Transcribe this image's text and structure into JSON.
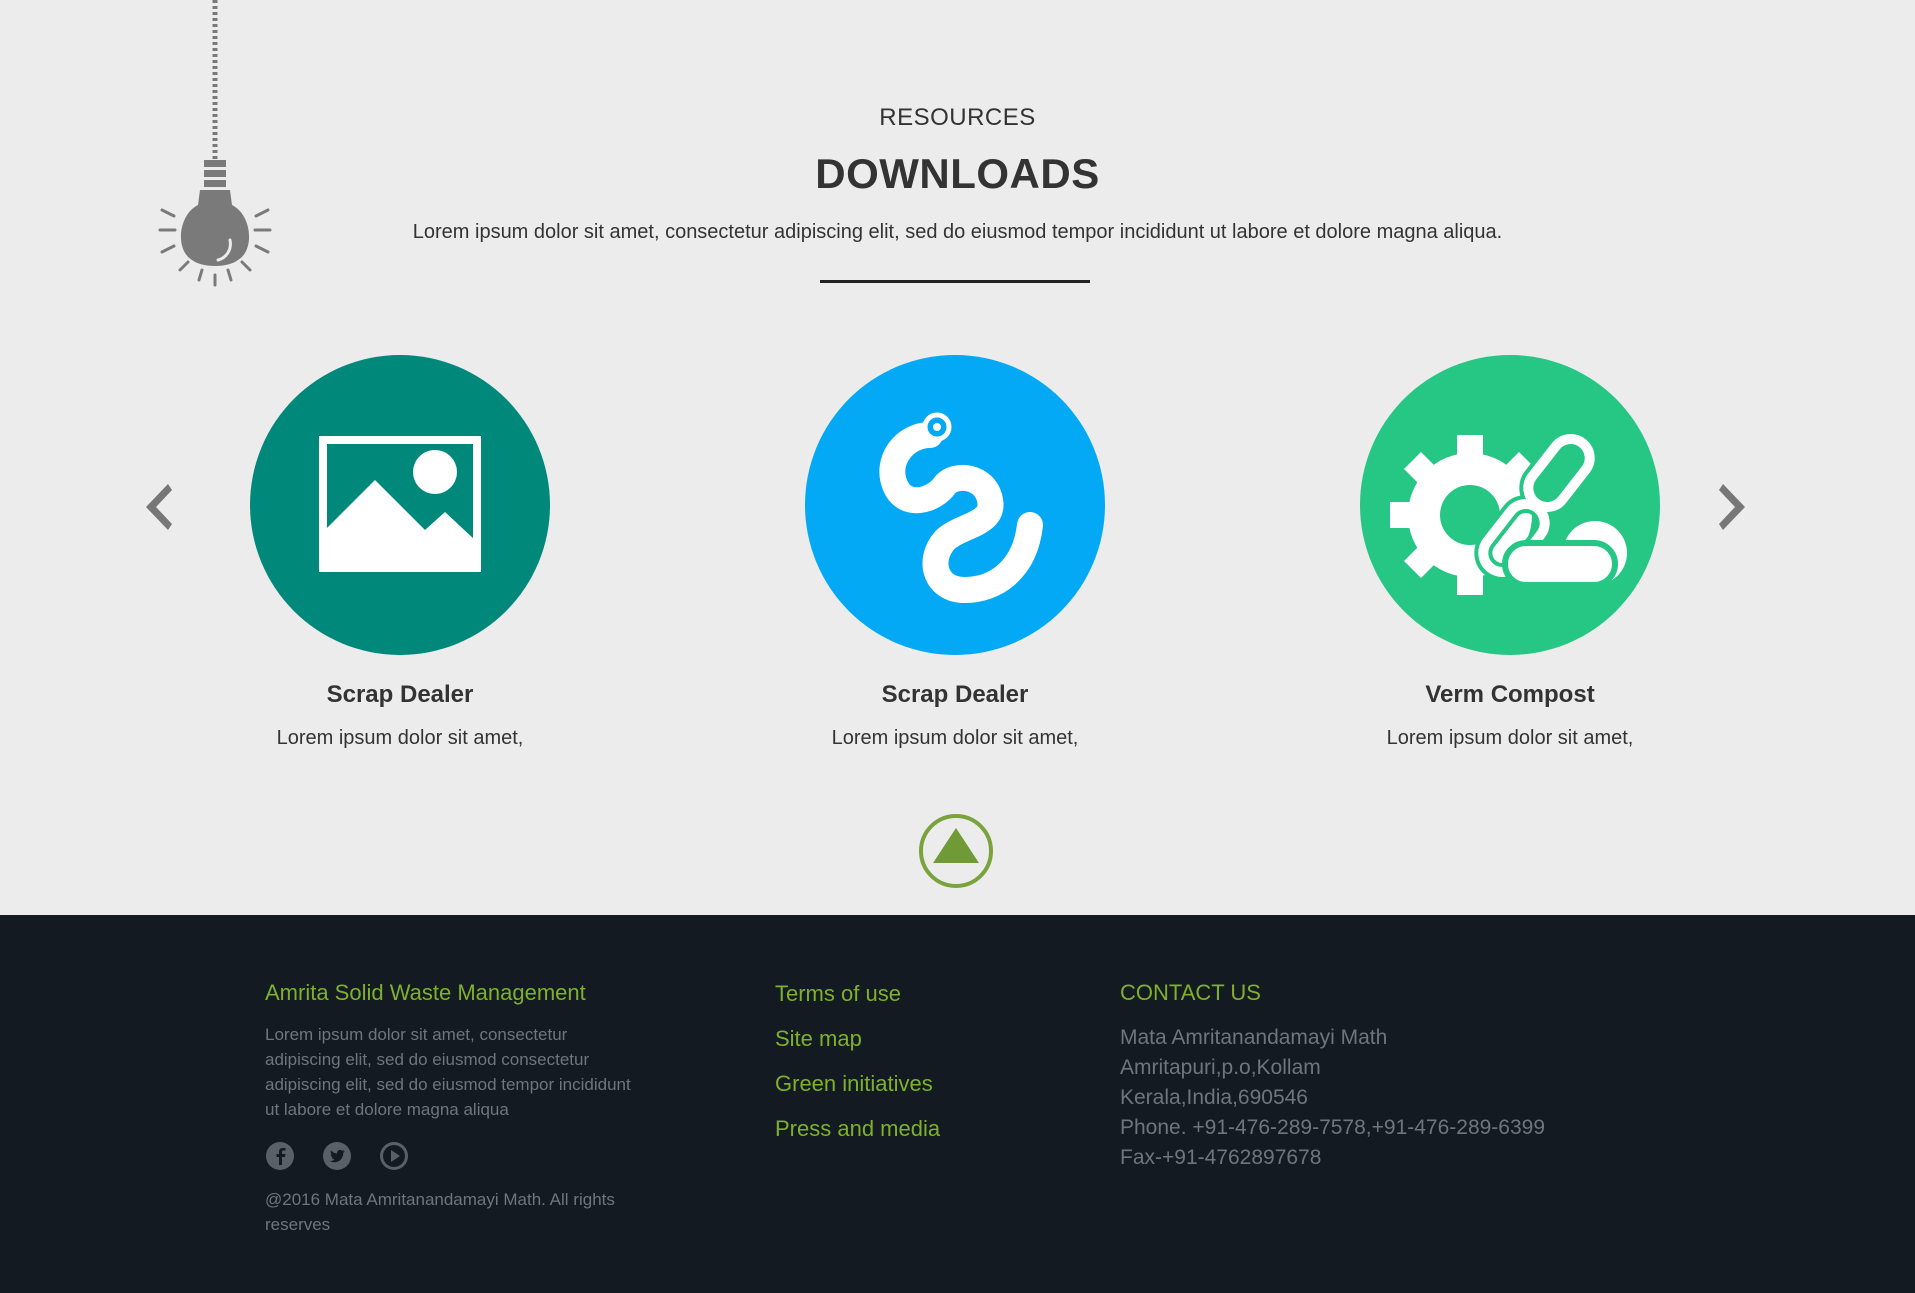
{
  "colors": {
    "background": "#ececec",
    "card1": "#00897b",
    "card2": "#03a9f4",
    "card3": "#26c684",
    "footer_bg": "#131a21",
    "accent_green": "#7fb02c",
    "footer_text": "#70757c"
  },
  "section": {
    "eyebrow": "RESOURCES",
    "title": "DOWNLOADS",
    "subtitle": "Lorem ipsum dolor sit amet, consectetur adipiscing elit, sed do eiusmod tempor incididunt ut labore et dolore magna aliqua."
  },
  "carousel": {
    "prev_icon": "chevron-left-icon",
    "next_icon": "chevron-right-icon",
    "cards": [
      {
        "title": "Scrap Dealer",
        "desc": "Lorem ipsum dolor sit amet,",
        "icon": "image-icon"
      },
      {
        "title": "Scrap Dealer",
        "desc": "Lorem ipsum dolor sit amet,",
        "icon": "worm-icon"
      },
      {
        "title": "Verm Compost",
        "desc": "Lorem ipsum dolor sit amet,",
        "icon": "gear-chain-icon"
      }
    ]
  },
  "footer": {
    "brand": "Amrita Solid Waste Management",
    "about": "Lorem ipsum dolor sit amet, consectetur adipiscing elit, sed do eiusmod consectetur adipiscing elit, sed do eiusmod tempor incididunt ut labore et dolore magna aliqua",
    "social": [
      "facebook-icon",
      "twitter-icon",
      "youtube-icon"
    ],
    "copyright": "@2016 Mata Amritanandamayi Math. All rights reserves",
    "links": [
      "Terms of use",
      "Site map",
      "Green initiatives",
      "Press and media"
    ],
    "contact_heading": "CONTACT US",
    "contact_lines": [
      "Mata Amritanandamayi Math",
      "Amritapuri,p.o,Kollam",
      "Kerala,India,690546",
      "Phone. +91-476-289-7578,+91-476-289-6399",
      "Fax-+91-4762897678"
    ]
  }
}
